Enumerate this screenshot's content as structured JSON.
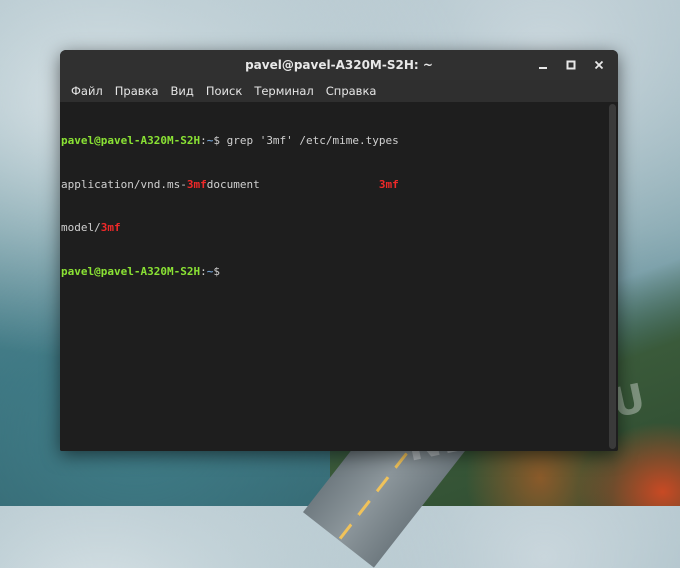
{
  "window": {
    "title": "pavel@pavel-A320M-S2H: ~",
    "controls": [
      "minimize-icon",
      "maximize-icon",
      "close-icon"
    ]
  },
  "menu": {
    "items": [
      "Файл",
      "Правка",
      "Вид",
      "Поиск",
      "Терминал",
      "Справка"
    ]
  },
  "terminal": {
    "line1": {
      "prompt": "pavel@pavel-A320M-S2H",
      "colon": ":",
      "path": "~",
      "symbol": "$ ",
      "command": "grep '3mf' /etc/mime.types"
    },
    "line2": {
      "prefix": "application/vnd.ms-",
      "match": "3mf",
      "suffix": "document                  ",
      "match2": "3mf"
    },
    "line3": {
      "prefix": "model/",
      "match": "3mf"
    },
    "line4": {
      "prompt": "pavel@pavel-A320M-S2H",
      "colon": ":",
      "path": "~",
      "symbol": "$"
    }
  },
  "desktop": {
    "watermark": "NEVOR.RU"
  },
  "colors": {
    "prompt": "#8ae234",
    "path": "#729fcf",
    "highlight": "#ef2929",
    "terminal_bg": "#1e1e1e",
    "titlebar_bg": "#303030"
  }
}
